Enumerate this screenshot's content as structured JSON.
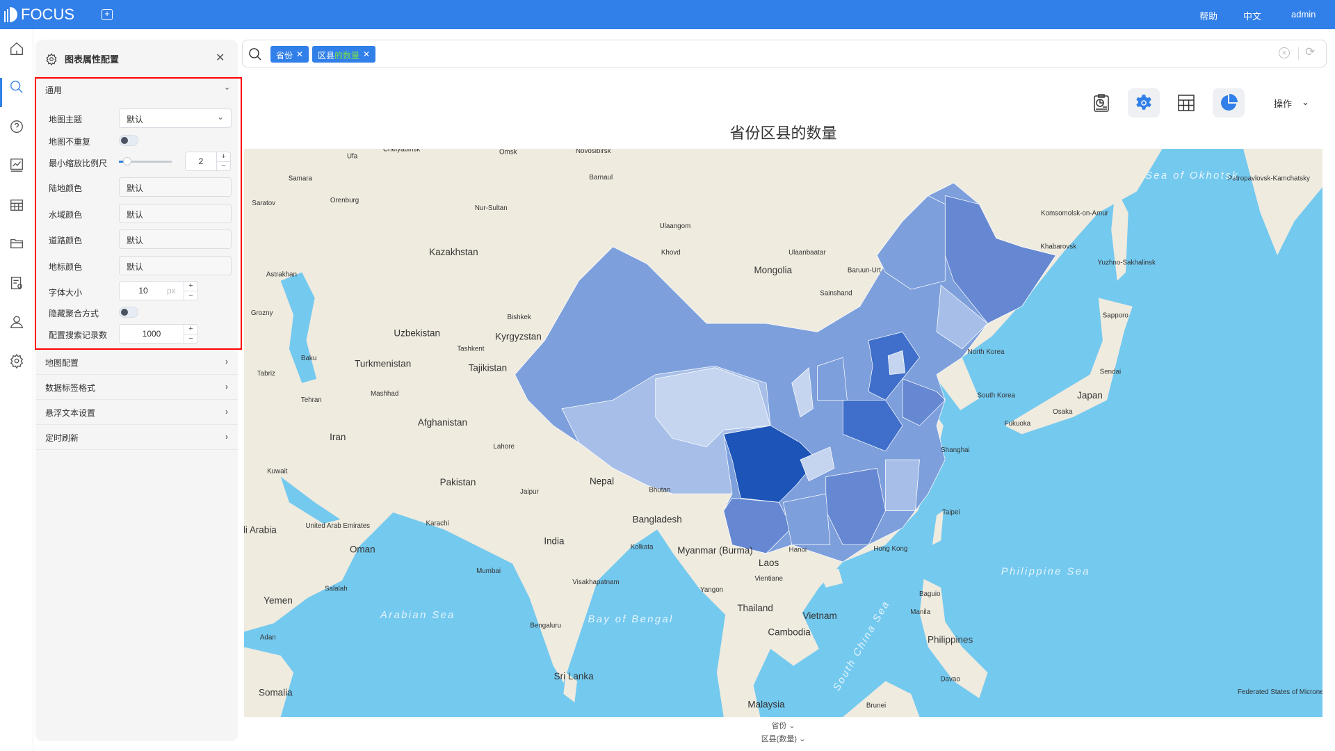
{
  "header": {
    "brand": "FOCUS",
    "links": [
      "帮助",
      "中文",
      "admin"
    ]
  },
  "nav": {
    "items": [
      "home",
      "search",
      "help",
      "chart",
      "table",
      "folder",
      "report-settings",
      "user",
      "settings"
    ],
    "active": 1
  },
  "panel": {
    "title": "图表属性配置",
    "general": {
      "label": "通用",
      "map_theme": {
        "label": "地图主题",
        "value": "默认"
      },
      "no_repeat": {
        "label": "地图不重复",
        "on": false
      },
      "min_zoom": {
        "label": "最小缩放比例尺",
        "value": "2",
        "slider_fraction": 0.05
      },
      "land_color": {
        "label": "陆地颜色",
        "value": "默认"
      },
      "water_color": {
        "label": "水域颜色",
        "value": "默认"
      },
      "road_color": {
        "label": "道路颜色",
        "value": "默认"
      },
      "landmark_color": {
        "label": "地标颜色",
        "value": "默认"
      },
      "font_size": {
        "label": "字体大小",
        "value": "10",
        "unit": "px"
      },
      "hide_agg": {
        "label": "隐藏聚合方式",
        "on": false
      },
      "search_records": {
        "label": "配置搜索记录数",
        "value": "1000"
      }
    },
    "sections": [
      "地图配置",
      "数据标签格式",
      "悬浮文本设置",
      "定时刷新"
    ]
  },
  "search": {
    "tags": [
      {
        "label": "省份"
      },
      {
        "label_a": "区县",
        "label_b": "的数量"
      }
    ]
  },
  "toolbar": {
    "action_label": "操作"
  },
  "chart": {
    "title": "省份区县的数量",
    "x_field": "省份",
    "y_field": "区县(数量)"
  },
  "colors": {
    "brand": "#317fe8",
    "water": "#74c9ef",
    "land": "#efebdf",
    "choropleth": [
      "#c5d5ef",
      "#a7bfe8",
      "#7d9fdc",
      "#6688d2",
      "#3f6fca",
      "#1c54b8"
    ]
  },
  "map": {
    "labels": [
      "Chelyabinsk",
      "Omsk",
      "Novosibirsk",
      "Ufa",
      "Samara",
      "Barnaul",
      "Saratov",
      "Orenburg",
      "Nur-Sultan",
      "Ulaangom",
      "Kazakhstan",
      "Khovd",
      "Ulaanbaatar",
      "Mongolia",
      "Baruun-Urt",
      "Sainshand",
      "Astrakhan",
      "Grozny",
      "Bishkek",
      "Uzbekistan",
      "Kyrgyzstan",
      "Tashkent",
      "Baku",
      "Turkmenistan",
      "Tajikistan",
      "Tabriz",
      "Mashhad",
      "Tehran",
      "Afghanistan",
      "Iran",
      "Lahore",
      "Kuwait",
      "Pakistan",
      "Nepal",
      "Bhutan",
      "Jaipur",
      "Karachi",
      "Bangladesh",
      "Kolkata",
      "India",
      "Myanmar (Burma)",
      "Laos",
      "Hanoi",
      "Vientiane",
      "United Arab Emirates",
      "Oman",
      "Mumbai",
      "Visakhapatnam",
      "Yangon",
      "Thailand",
      "Vietnam",
      "Cambodia",
      "Bengaluru",
      "Sri Lanka",
      "Yemen",
      "Salalah",
      "Adan",
      "Somalia",
      "Malaysia",
      "Brunei",
      "Philippines",
      "Manila",
      "Baguio",
      "Davao",
      "North Korea",
      "South Korea",
      "Japan",
      "Fukuoka",
      "Osaka",
      "Sendai",
      "Sapporo",
      "Shanghai",
      "Taipei",
      "Hong Kong",
      "Khabarovsk",
      "Komsomolsk-on-Amur",
      "Petropavlovsk-Kamchatsky",
      "Yuzhno-Sakhalinsk",
      "Sea of Okhotsk",
      "Philippine Sea",
      "Arabian Sea",
      "Bay of Bengal",
      "South China Sea",
      "Federated States of Micronesia",
      "Saudi Arabia"
    ]
  }
}
